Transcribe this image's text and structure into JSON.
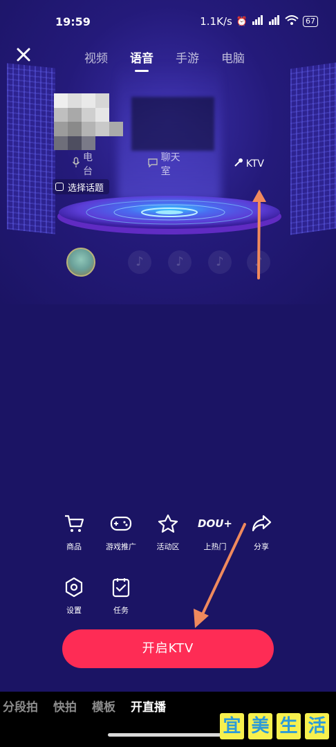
{
  "status_bar": {
    "time": "19:59",
    "network_speed": "1.1K/s",
    "battery": "67",
    "icons": [
      "alarm-icon",
      "signal-hd-icon",
      "signal-hd-icon",
      "wifi-icon",
      "battery-icon"
    ]
  },
  "header": {
    "close_icon": "close-icon",
    "tabs": [
      {
        "label": "视频",
        "active": false
      },
      {
        "label": "语音",
        "active": true
      },
      {
        "label": "手游",
        "active": false
      },
      {
        "label": "电脑",
        "active": false
      }
    ]
  },
  "voice_modes": [
    {
      "label": "电台",
      "icon": "microphone-icon",
      "selected": false
    },
    {
      "label": "聊天室",
      "icon": "chat-bubble-icon",
      "selected": false
    },
    {
      "label": "KTV",
      "icon": "karaoke-mic-icon",
      "selected": true
    }
  ],
  "topic_chip": {
    "label": "选择话题"
  },
  "tools_row1": [
    {
      "label": "商品",
      "icon": "cart-icon"
    },
    {
      "label": "游戏推广",
      "icon": "gamepad-icon"
    },
    {
      "label": "活动区",
      "icon": "star-icon"
    },
    {
      "label": "上热门",
      "icon": "dou-plus-icon",
      "icon_text": "DOU+"
    },
    {
      "label": "分享",
      "icon": "share-arrow-icon"
    }
  ],
  "tools_row2": [
    {
      "label": "设置",
      "icon": "settings-hexagon-icon"
    },
    {
      "label": "任务",
      "icon": "task-clipboard-icon"
    }
  ],
  "start_button": {
    "label": "开启KTV"
  },
  "bottom_modes": [
    {
      "label": "分段拍",
      "active": false
    },
    {
      "label": "快拍",
      "active": false
    },
    {
      "label": "模板",
      "active": false
    },
    {
      "label": "开直播",
      "active": true
    }
  ],
  "watermark": [
    "宜",
    "美",
    "生",
    "活"
  ],
  "colors": {
    "background": "#1b1464",
    "accent": "#fe2c55",
    "annotation_arrow": "#f08a5d",
    "watermark_bg": "#f7f04e",
    "watermark_text": "#2c9ad9"
  }
}
